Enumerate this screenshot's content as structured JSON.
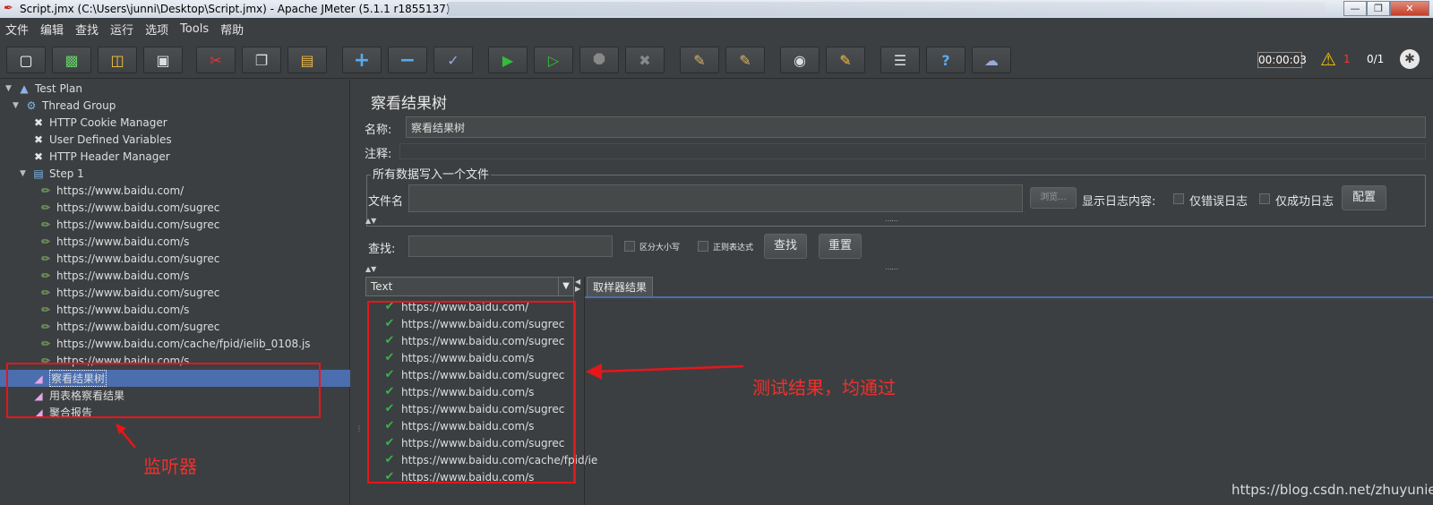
{
  "window": {
    "title": "Script.jmx (C:\\Users\\junni\\Desktop\\Script.jmx) - Apache JMeter (5.1.1 r1855137)"
  },
  "menu": [
    "文件",
    "编辑",
    "查找",
    "运行",
    "选项",
    "Tools",
    "帮助"
  ],
  "toolbar": {
    "buttons": [
      "new-icon",
      "templates-icon",
      "open-icon",
      "save-icon",
      "cut-icon",
      "copy-icon",
      "paste-icon",
      "expand-icon",
      "collapse-icon",
      "toggle-icon",
      "start-icon",
      "start-no-pause-icon",
      "stop-icon",
      "shutdown-icon",
      "clear-icon",
      "clear-all-icon",
      "search-icon",
      "reset-search-icon",
      "function-helper-icon",
      "help-icon",
      "remote-icon"
    ],
    "timer": "00:00:03",
    "warning_count": "1",
    "threads": "0/1"
  },
  "tree": {
    "test_plan": "Test Plan",
    "thread_group": "Thread Group",
    "configs": [
      "HTTP Cookie Manager",
      "User Defined Variables",
      "HTTP Header Manager"
    ],
    "step": "Step 1",
    "samplers": [
      "https://www.baidu.com/",
      "https://www.baidu.com/sugrec",
      "https://www.baidu.com/sugrec",
      "https://www.baidu.com/s",
      "https://www.baidu.com/sugrec",
      "https://www.baidu.com/s",
      "https://www.baidu.com/sugrec",
      "https://www.baidu.com/s",
      "https://www.baidu.com/sugrec",
      "https://www.baidu.com/cache/fpid/ielib_0108.js",
      "https://www.baidu.com/s"
    ],
    "listeners": [
      "察看结果树",
      "用表格察看结果",
      "聚合报告"
    ]
  },
  "panel": {
    "title": "察看结果树",
    "name_label": "名称:",
    "name_value": "察看结果树",
    "comment_label": "注释:",
    "file_group_title": "所有数据写入一个文件",
    "filename_label": "文件名",
    "browse_button": "浏览...",
    "log_content_label": "显示日志内容:",
    "errors_only": "仅错误日志",
    "success_only": "仅成功日志",
    "configure_button": "配置",
    "search_label": "查找:",
    "case_sensitive": "区分大小写",
    "regex": "正则表达式",
    "search_button": "查找",
    "reset_button": "重置",
    "renderer": "Text",
    "result_tab": "取样器结果",
    "results": [
      "https://www.baidu.com/",
      "https://www.baidu.com/sugrec",
      "https://www.baidu.com/sugrec",
      "https://www.baidu.com/s",
      "https://www.baidu.com/sugrec",
      "https://www.baidu.com/s",
      "https://www.baidu.com/sugrec",
      "https://www.baidu.com/s",
      "https://www.baidu.com/sugrec",
      "https://www.baidu.com/cache/fpid/ie",
      "https://www.baidu.com/s"
    ]
  },
  "annotations": {
    "listener_note": "监听器",
    "result_note": "测试结果，均通过",
    "color": "#e8151a"
  },
  "watermark": "https://blog.csdn.net/zhuyunier"
}
